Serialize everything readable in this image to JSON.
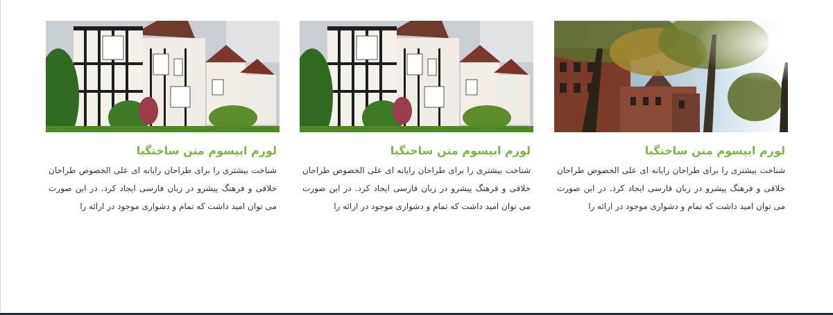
{
  "cards": [
    {
      "title": "لورم ایپسوم متن ساختگیا",
      "text": "شناخت بیشتری را برای طراحان رایانه ای علی الخصوص طراحان خلاقی و فرهنگ پیشرو در زبان فارسی ایجاد کرد. در این صورت می توان امید داشت که تمام و دشواری موجود در ارائه را",
      "image": "tree-lined-street-photo"
    },
    {
      "title": "لورم ایپسوم متن ساختگیا",
      "text": "شناخت بیشتری را برای طراحان رایانه ای علی الخصوص طراحان خلاقی و فرهنگ پیشرو در زبان فارسی ایجاد کرد. در این صورت می توان امید داشت که تمام و دشواری موجود در ارائه را",
      "image": "tudor-houses-photo"
    },
    {
      "title": "لورم ایپسوم متن ساختگیا",
      "text": "شناخت بیشتری را برای طراحان رایانه ای علی الخصوص طراحان خلاقی و فرهنگ پیشرو در زبان فارسی ایجاد کرد. در این صورت می توان امید داشت که تمام و دشواری موجود در ارائه را",
      "image": "tudor-houses-photo"
    }
  ],
  "colors": {
    "title_green": "#7ab648",
    "body_text": "#333333",
    "footer_bar": "#1f2d33"
  }
}
